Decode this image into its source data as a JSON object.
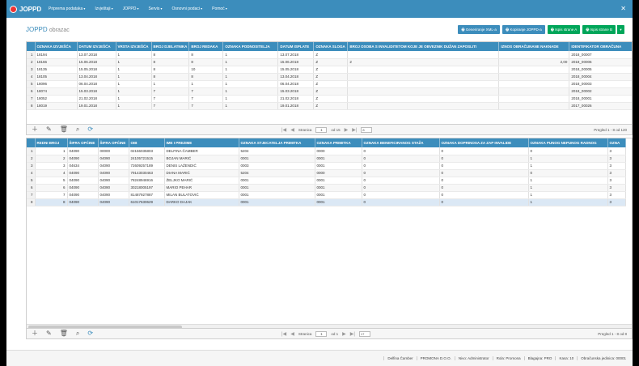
{
  "app": {
    "logo": "JOPPD"
  },
  "menu": [
    "Priprema podataka",
    "Izvještaji",
    "JOPPD",
    "Servis",
    "Osnovni podaci",
    "Pomoć"
  ],
  "title": {
    "main": "JOPPD",
    "sub": "obrazac"
  },
  "buttons": {
    "generate_xml": "Generiranje XML-a",
    "copy_joppd": "Kopiranje JOPPD-a",
    "print_a": "Ispis strane A",
    "print_b": "Ispis strane B"
  },
  "top_grid": {
    "columns": [
      "",
      "OZNAKA IZVJEŠĆA",
      "DATUM IZVJEŠĆA",
      "VRSTA IZVJEŠĆA",
      "BROJ DJELATNIKA",
      "BROJ REDAKA",
      "OZNAKA PODNOSITELJA",
      "DATUM ISPLATE",
      "OZNAKA SLOGA",
      "BROJ OSOBA S INVALIDITETOM KOJE JE OBVEZNIK DUŽAN ZAPOSLITI",
      "IZNOS OBRAČUNANE NAKNADE",
      "IDENTIFIKATOR OBRAČUNA"
    ],
    "rows": [
      [
        "1",
        "18194",
        "13.07.2018",
        "1",
        "8",
        "8",
        "1",
        "13.07.2018",
        "Z",
        "",
        "",
        "2018_00007"
      ],
      [
        "2",
        "18166",
        "15.06.2018",
        "1",
        "8",
        "8",
        "1",
        "15.06.2018",
        "Z",
        "2",
        "2,00",
        "2018_00006"
      ],
      [
        "3",
        "18135",
        "15.05.2018",
        "1",
        "8",
        "10",
        "1",
        "15.05.2018",
        "Z",
        "",
        "",
        "2018_00005"
      ],
      [
        "4",
        "18105",
        "13.04.2018",
        "1",
        "8",
        "8",
        "1",
        "13.04.2018",
        "Z",
        "",
        "",
        "2018_00004"
      ],
      [
        "5",
        "18096",
        "06.04.2018",
        "1",
        "1",
        "1",
        "1",
        "06.04.2018",
        "Z",
        "",
        "",
        "2018_00003"
      ],
      [
        "6",
        "18074",
        "15.03.2018",
        "1",
        "7",
        "7",
        "1",
        "15.03.2018",
        "Z",
        "",
        "",
        "2018_00002"
      ],
      [
        "7",
        "18052",
        "21.02.2018",
        "1",
        "7",
        "7",
        "1",
        "21.02.2018",
        "Z",
        "",
        "",
        "2018_00001"
      ],
      [
        "8",
        "18019",
        "19.01.2018",
        "1",
        "7",
        "7",
        "1",
        "19.01.2018",
        "Z",
        "",
        "",
        "2017_00026"
      ]
    ]
  },
  "top_pager": {
    "page_label": "Stranica",
    "page": "1",
    "of": "od 15",
    "page_size": "8",
    "info": "Pregled 1 - 8 od 120"
  },
  "bottom_grid": {
    "columns": [
      "",
      "REDNI BROJ",
      "ŠIFRA OPĆINE",
      "ŠIFRA OPĆINE",
      "OIB",
      "IME I PREZIME",
      "OZNAKA STJECATELJA PRIMITKA",
      "OZNAKA PRIMITKA",
      "OZNAKA BENEFICIRANOG STAŽA",
      "OZNAKA DOPRINOSA ZA ZAP INVALIDE",
      "OZNAKA PUNOG NEPUNOG RADNOG",
      "OZNA"
    ],
    "rows": [
      [
        "1",
        "1",
        "04090",
        "00000",
        "02156035803",
        "DELFINA ČAMBER",
        "5204",
        "0000",
        "0",
        "0",
        "0",
        "3"
      ],
      [
        "2",
        "2",
        "04090",
        "04090",
        "24105721515",
        "BOJAN MARIĆ",
        "0001",
        "0001",
        "0",
        "0",
        "1",
        "3"
      ],
      [
        "3",
        "3",
        "04634",
        "04090",
        "72609257189",
        "DENIS LAŽENDIĆ",
        "0003",
        "0001",
        "0",
        "0",
        "1",
        "3"
      ],
      [
        "4",
        "4",
        "04090",
        "04090",
        "79143030463",
        "DIANA MARIĆ",
        "5204",
        "0000",
        "0",
        "0",
        "0",
        "3"
      ],
      [
        "5",
        "5",
        "04090",
        "04090",
        "78248946916",
        "ŽELJKO MARIĆ",
        "0001",
        "0001",
        "0",
        "0",
        "1",
        "3"
      ],
      [
        "6",
        "6",
        "04090",
        "04090",
        "30218005197",
        "MARIO PEHAR",
        "0001",
        "0001",
        "0",
        "0",
        "1",
        "3"
      ],
      [
        "7",
        "7",
        "04090",
        "04090",
        "81487927887",
        "MILAN BULATOVIĆ",
        "0001",
        "0001",
        "0",
        "0",
        "1",
        "3"
      ],
      [
        "8",
        "8",
        "04090",
        "04090",
        "61017630629",
        "DARKO DAJAK",
        "0001",
        "0001",
        "0",
        "0",
        "1",
        "3"
      ]
    ]
  },
  "bottom_pager": {
    "page_label": "Stranica",
    "page": "1",
    "of": "od 1",
    "page_size": "17",
    "info": "Pregled 1 - 8 od 8"
  },
  "status": [
    "Delfina Čamber",
    "PROMONA D.O.O.",
    "Nivo: Administrator",
    "Rola: Promona",
    "Blagajna: PRO",
    "Kasa: 10",
    "Obračunska jedinica: 00001"
  ]
}
